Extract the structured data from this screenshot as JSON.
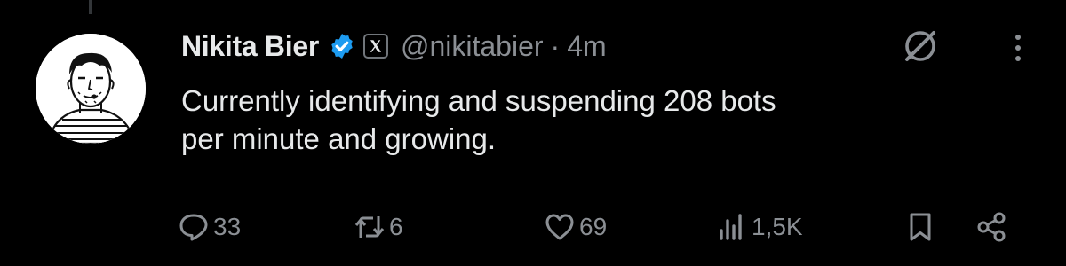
{
  "tweet": {
    "author": {
      "display_name": "Nikita Bier",
      "handle": "@nikitabier",
      "verified": true,
      "affiliate_badge": "x-logo-icon"
    },
    "separator": "·",
    "timestamp": "4m",
    "text_lines": [
      "Currently identifying and suspending 208 bots",
      "per minute and growing."
    ],
    "actions": {
      "replies": "33",
      "reposts": "6",
      "likes": "69",
      "views": "1,5K"
    }
  },
  "icons": {
    "header": [
      "grok-icon",
      "more-options-icon"
    ],
    "actions": [
      "reply-icon",
      "repost-icon",
      "like-icon",
      "views-icon",
      "bookmark-icon",
      "share-icon"
    ]
  },
  "colors": {
    "background": "#000000",
    "primary_text": "#e7e9ea",
    "secondary_text": "#8b8f94",
    "verified_blue": "#1d9bf0"
  }
}
